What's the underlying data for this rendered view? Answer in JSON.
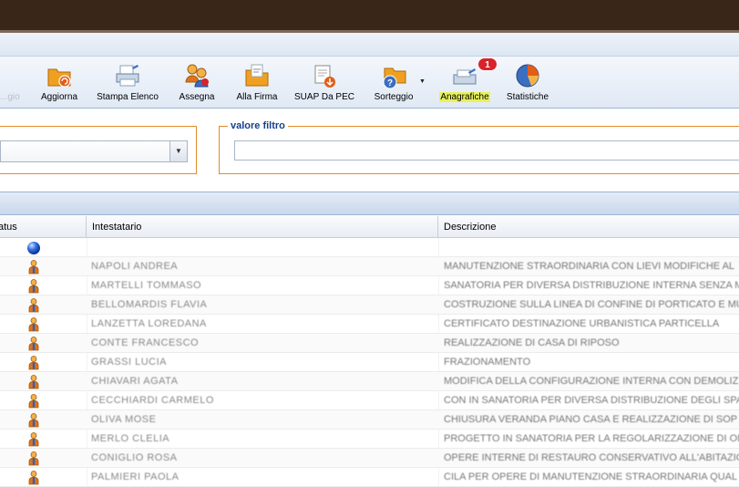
{
  "toolbar": {
    "disabled_label": "...gio",
    "buttons": [
      {
        "key": "aggiorna",
        "label": "Aggiorna",
        "icon": "folder-refresh-icon"
      },
      {
        "key": "stampa_elenco",
        "label": "Stampa Elenco",
        "icon": "printer-icon"
      },
      {
        "key": "assegna",
        "label": "Assegna",
        "icon": "users-assign-icon"
      },
      {
        "key": "alla_firma",
        "label": "Alla Firma",
        "icon": "folder-sign-icon"
      },
      {
        "key": "suap_da_pec",
        "label": "SUAP Da PEC",
        "icon": "pec-import-icon"
      },
      {
        "key": "sorteggio",
        "label": "Sorteggio",
        "icon": "folder-question-icon"
      },
      {
        "key": "anagrafiche",
        "label": "Anagrafiche",
        "icon": "registry-icon",
        "badge": "1"
      },
      {
        "key": "statistiche",
        "label": "Statistiche",
        "icon": "pie-chart-icon"
      }
    ]
  },
  "filter": {
    "value_label": "valore filtro",
    "value": ""
  },
  "grid": {
    "columns": [
      "atus",
      "Intestatario",
      "Descrizione"
    ],
    "rows": [
      {
        "status": "globe",
        "intestatario": "",
        "descrizione": ""
      },
      {
        "status": "user",
        "intestatario": "NAPOLI ANDREA",
        "descrizione": "MANUTENZIONE STRAORDINARIA CON LIEVI MODIFICHE AL"
      },
      {
        "status": "user",
        "intestatario": "MARTELLI TOMMASO",
        "descrizione": "SANATORIA PER DIVERSA DISTRIBUZIONE INTERNA SENZA M"
      },
      {
        "status": "user",
        "intestatario": "BELLOMARDIS FLAVIA",
        "descrizione": "COSTRUZIONE SULLA LINEA DI CONFINE DI PORTICATO E MURO"
      },
      {
        "status": "user",
        "intestatario": "LANZETTA LOREDANA",
        "descrizione": "CERTIFICATO DESTINAZIONE URBANISTICA PARTICELLA"
      },
      {
        "status": "user",
        "intestatario": "CONTE FRANCESCO",
        "descrizione": "REALIZZAZIONE DI CASA DI RIPOSO"
      },
      {
        "status": "user",
        "intestatario": "GRASSI LUCIA",
        "descrizione": "FRAZIONAMENTO"
      },
      {
        "status": "user",
        "intestatario": "CHIAVARI AGATA",
        "descrizione": "MODIFICA DELLA CONFIGURAZIONE INTERNA CON DEMOLIZ"
      },
      {
        "status": "user",
        "intestatario": "CECCHIARDI CARMELO",
        "descrizione": "CON IN SANATORIA PER DIVERSA DISTRIBUZIONE DEGLI SPA"
      },
      {
        "status": "user",
        "intestatario": "OLIVA MOSE",
        "descrizione": "CHIUSURA VERANDA PIANO CASA E REALIZZAZIONE DI SOP"
      },
      {
        "status": "user",
        "intestatario": "MERLO CLELIA",
        "descrizione": "PROGETTO IN SANATORIA PER LA REGOLARIZZAZIONE DI OP"
      },
      {
        "status": "user",
        "intestatario": "CONIGLIO ROSA",
        "descrizione": "OPERE INTERNE DI RESTAURO CONSERVATIVO ALL'ABITAZIO"
      },
      {
        "status": "user",
        "intestatario": "PALMIERI PAOLA",
        "descrizione": "CILA PER OPERE DI MANUTENZIONE STRAORDINARIA QUAL"
      }
    ]
  },
  "colors": {
    "topbar": "#3a2618",
    "accent_orange": "#e28b2b",
    "header_blue": "#15428b",
    "badge_red": "#d8232a",
    "highlight": "#e8f25a"
  }
}
